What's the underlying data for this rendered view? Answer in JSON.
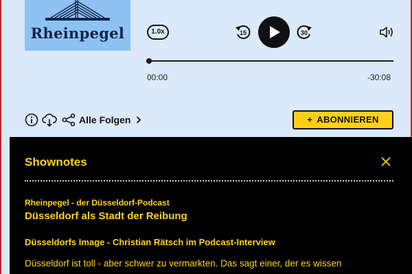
{
  "podcast": {
    "cover_title": "Rheinpegel",
    "cover_bg": "#8ec2f2",
    "cover_icon": "bridge-illustration"
  },
  "player": {
    "speed": "1.0x",
    "skip_back_seconds": "15",
    "skip_forward_seconds": "30",
    "play_icon": "play-icon",
    "volume_icon": "speaker-icon",
    "progress_fraction": 0.0,
    "current_time": "00:00",
    "remaining_time": "-30:08"
  },
  "actions": {
    "info_icon": "info-icon",
    "download_icon": "download-cloud-icon",
    "share_icon": "share-icon",
    "all_episodes_label": "Alle Folgen",
    "subscribe_label": "ABONNIEREN",
    "subscribe_color": "#ffcf1a"
  },
  "shownotes": {
    "title": "Shownotes",
    "close_icon": "close-icon",
    "series": "Rheinpegel - der Düsseldorf-Podcast",
    "episode_title": "Düsseldorf als Stadt der Reibung",
    "heading": "Düsseldorfs Image - Christian Rätsch im Podcast-Interview",
    "body": "Düsseldorf ist toll - aber schwer zu vermarkten. Das sagt einer, der es wissen",
    "accent_color": "#ffd21a"
  }
}
